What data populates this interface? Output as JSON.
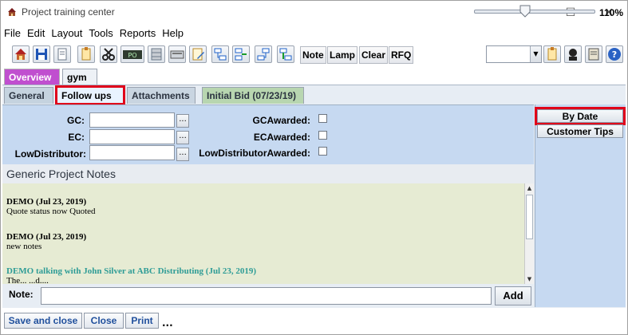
{
  "window": {
    "title": "Project training center",
    "min": "—",
    "max": "☐",
    "close": "✕"
  },
  "menu": [
    "File",
    "Edit",
    "Layout",
    "Tools",
    "Reports",
    "Help"
  ],
  "toolbar": {
    "text_buttons": [
      "Note",
      "Lamp",
      "Clear",
      "RFQ"
    ],
    "po_label": "PO",
    "combo_value": ""
  },
  "tabs_top": [
    "Overview",
    "gym"
  ],
  "tabs_sub": [
    "General",
    "Follow ups",
    "Attachments",
    "Initial Bid (07/23/19)"
  ],
  "fields": {
    "gc_label": "GC:",
    "ec_label": "EC:",
    "lowdist_label": "LowDistributor:",
    "gc_value": "",
    "ec_value": "",
    "lowdist_value": "",
    "dots": "...",
    "gc_awarded": "GCAwarded:",
    "ec_awarded": "ECAwarded:",
    "lowdist_awarded": "LowDistributorAwarded:"
  },
  "notes": {
    "title": "Generic Project Notes",
    "entries": [
      {
        "head": "DEMO (Jul 23, 2019)",
        "body": "Quote status now Quoted"
      },
      {
        "head": "DEMO (Jul 23, 2019)",
        "body": "new notes"
      },
      {
        "head": "DEMO talking with John Silver at ABC Distributing (Jul 23, 2019)",
        "body": "The... ...d...."
      }
    ],
    "note_label": "Note:",
    "note_value": "",
    "add_label": "Add"
  },
  "right": {
    "by_date": "By Date",
    "customer_tips": "Customer Tips"
  },
  "bottom": {
    "save_close": "Save and close",
    "close": "Close",
    "print": "Print",
    "more": "...",
    "zoom": "110%",
    "zoom_fraction": 0.42
  }
}
